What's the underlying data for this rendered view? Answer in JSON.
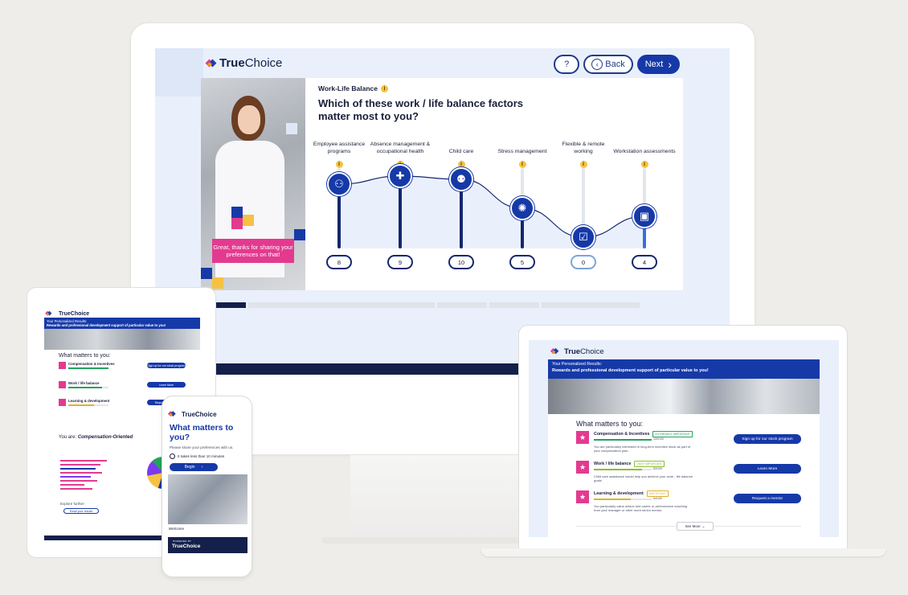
{
  "brand": {
    "name": "TrueChoice",
    "name_true": "True",
    "name_choice": "Choice",
    "accent": "#1639a8",
    "pink": "#e33a8f",
    "navy": "#14204a"
  },
  "desktop": {
    "nav": {
      "help": "?",
      "back": "Back",
      "next": "Next"
    },
    "category": "Work-Life Balance",
    "question": "Which of these work / life balance factors matter most to you?",
    "thanks": "Great, thanks for sharing your preferences on that!",
    "page_number": "1",
    "factors": [
      {
        "label": "Employee assistance programs",
        "value": 8,
        "icon": "people-star-icon"
      },
      {
        "label": "Absence management & occupational health",
        "value": 9,
        "icon": "medical-kit-icon"
      },
      {
        "label": "Child care",
        "value": 10,
        "icon": "family-icon"
      },
      {
        "label": "Stress management",
        "value": 5,
        "icon": "head-network-icon"
      },
      {
        "label": "Flexible & remote working",
        "value": 0,
        "icon": "calendar-check-icon"
      },
      {
        "label": "Workstation assessments",
        "value": 4,
        "icon": "monitor-icon"
      }
    ],
    "scale_max": 10
  },
  "tablet": {
    "banner_line1": "Your Personalized Results:",
    "banner_line2": "Rewards and professional development support of particular value to you!",
    "heading": "What matters to you:",
    "items": [
      {
        "title": "Compensation & Incentives",
        "button": "Sign up for our stock program"
      },
      {
        "title": "Work / life balance",
        "button": "Learn More"
      },
      {
        "title": "Learning & development",
        "button": "Request a mentor"
      }
    ],
    "you_are": "You are:",
    "you_are_type": "Compensation-Oriented",
    "explore": "Explore further:",
    "email": "Email your results"
  },
  "phone": {
    "heading": "What matters to you?",
    "subtext": "Please share your preferences with us.",
    "time": "It takes less than 10 minutes",
    "begin": "Begin",
    "welcome": "Welcome",
    "powered_by": "POWERED BY"
  },
  "laptop": {
    "banner_line1": "Your Personalized Results:",
    "banner_line2": "Rewards and professional development support of particular value to you!",
    "heading": "What matters to you:",
    "items": [
      {
        "title": "Compensation & Incentives",
        "badge": "EXTREMELY IMPORTANT",
        "score": "100/100",
        "score_fraction": 1.0,
        "desc": "You are particularly interested in long-term incentive stock as part of your compensation plan.",
        "button": "Sign up for our stock program",
        "badge_color": "#22a35a"
      },
      {
        "title": "Work / life balance",
        "badge": "VERY IMPORTANT",
        "score": "83/100",
        "score_fraction": 0.83,
        "desc": "Child care assistance would help you achieve your work - life balance goals.",
        "button": "Learn More",
        "badge_color": "#8bbf2f"
      },
      {
        "title": "Learning & development",
        "badge": "IMPORTANT",
        "score": "64/100",
        "score_fraction": 0.64,
        "desc": "You particularly value advice and career or performance coaching from your manager or other more senior mentor.",
        "button": "Request a mentor",
        "badge_color": "#e1b12c"
      }
    ],
    "see_more": "See More"
  }
}
